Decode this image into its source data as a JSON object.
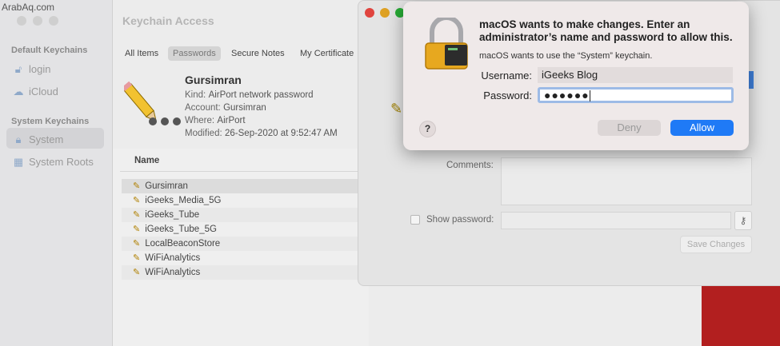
{
  "watermark": "ArabAq.com",
  "keychain": {
    "title": "Keychain Access",
    "sidebar": {
      "default_heading": "Default Keychains",
      "default_items": [
        {
          "label": "login",
          "icon": "unlock-icon"
        },
        {
          "label": "iCloud",
          "icon": "cloud-icon"
        }
      ],
      "system_heading": "System Keychains",
      "system_items": [
        {
          "label": "System",
          "icon": "lock-icon"
        },
        {
          "label": "System Roots",
          "icon": "cabinet-icon"
        }
      ]
    },
    "tabs": [
      "All Items",
      "Passwords",
      "Secure Notes",
      "My Certificate"
    ],
    "detail": {
      "name": "Gursimran",
      "kind_label": "Kind:",
      "kind": "AirPort network password",
      "account_label": "Account:",
      "account": "Gursimran",
      "where_label": "Where:",
      "where": "AirPort",
      "modified_label": "Modified:",
      "modified": "26-Sep-2020 at 9:52:47 AM"
    },
    "column_name": "Name",
    "rows": [
      "Gursimran",
      "iGeeks_Media_5G",
      "iGeeks_Tube",
      "iGeeks_Tube_5G",
      "LocalBeaconStore",
      "WiFiAnalytics",
      "WiFiAnalytics"
    ]
  },
  "item_window": {
    "comments_label": "Comments:",
    "show_password_label": "Show password:",
    "save_changes": "Save Changes"
  },
  "dialog": {
    "title": "macOS wants to make changes. Enter an administrator’s name and password to allow this.",
    "subtitle": "macOS wants to use the “System” keychain.",
    "username_label": "Username:",
    "username_value": "iGeeks Blog",
    "password_label": "Password:",
    "password_value": "●●●●●●",
    "help": "?",
    "deny": "Deny",
    "allow": "Allow"
  }
}
